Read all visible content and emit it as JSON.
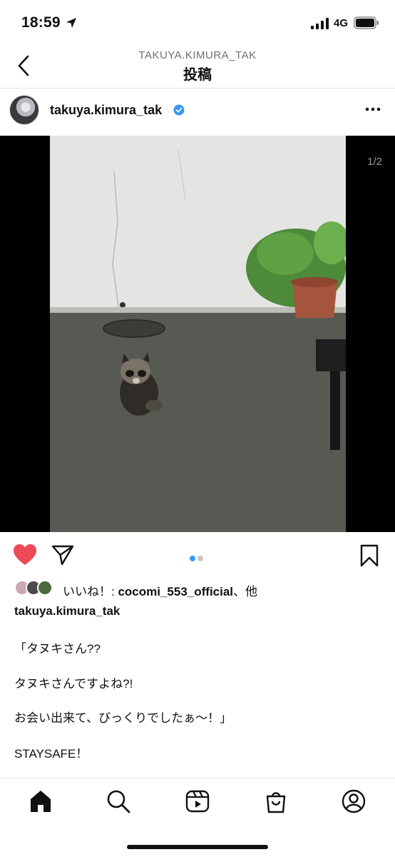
{
  "status_bar": {
    "time": "18:59",
    "network": "4G",
    "icons": [
      "location-arrow-icon",
      "signal-icon",
      "battery-icon"
    ]
  },
  "header": {
    "account_handle": "TAKUYA.KIMURA_TAK",
    "title": "投稿"
  },
  "post": {
    "author": "takuya.kimura_tak",
    "verified": true,
    "image_counter": "1/2",
    "carousel": {
      "current": 1,
      "total": 2
    },
    "likes": {
      "prefix": "いいね！: ",
      "user": "cocomi_553_official",
      "suffix": "、他"
    },
    "caption_author": "takuya.kimura_tak",
    "caption_lines": [
      "「タヌキさん??",
      "タヌキさんですよね?!",
      "お会い出来て、びっくりでしたぁ〜！」",
      "STAYSAFE！"
    ]
  },
  "bottom_nav": [
    "home-icon",
    "search-icon",
    "reels-icon",
    "shop-icon",
    "profile-icon"
  ],
  "colors": {
    "like_red": "#ed4956",
    "verified_blue": "#3897f0",
    "dot_active": "#3897f0",
    "dot_inactive": "#c7c7c7"
  }
}
